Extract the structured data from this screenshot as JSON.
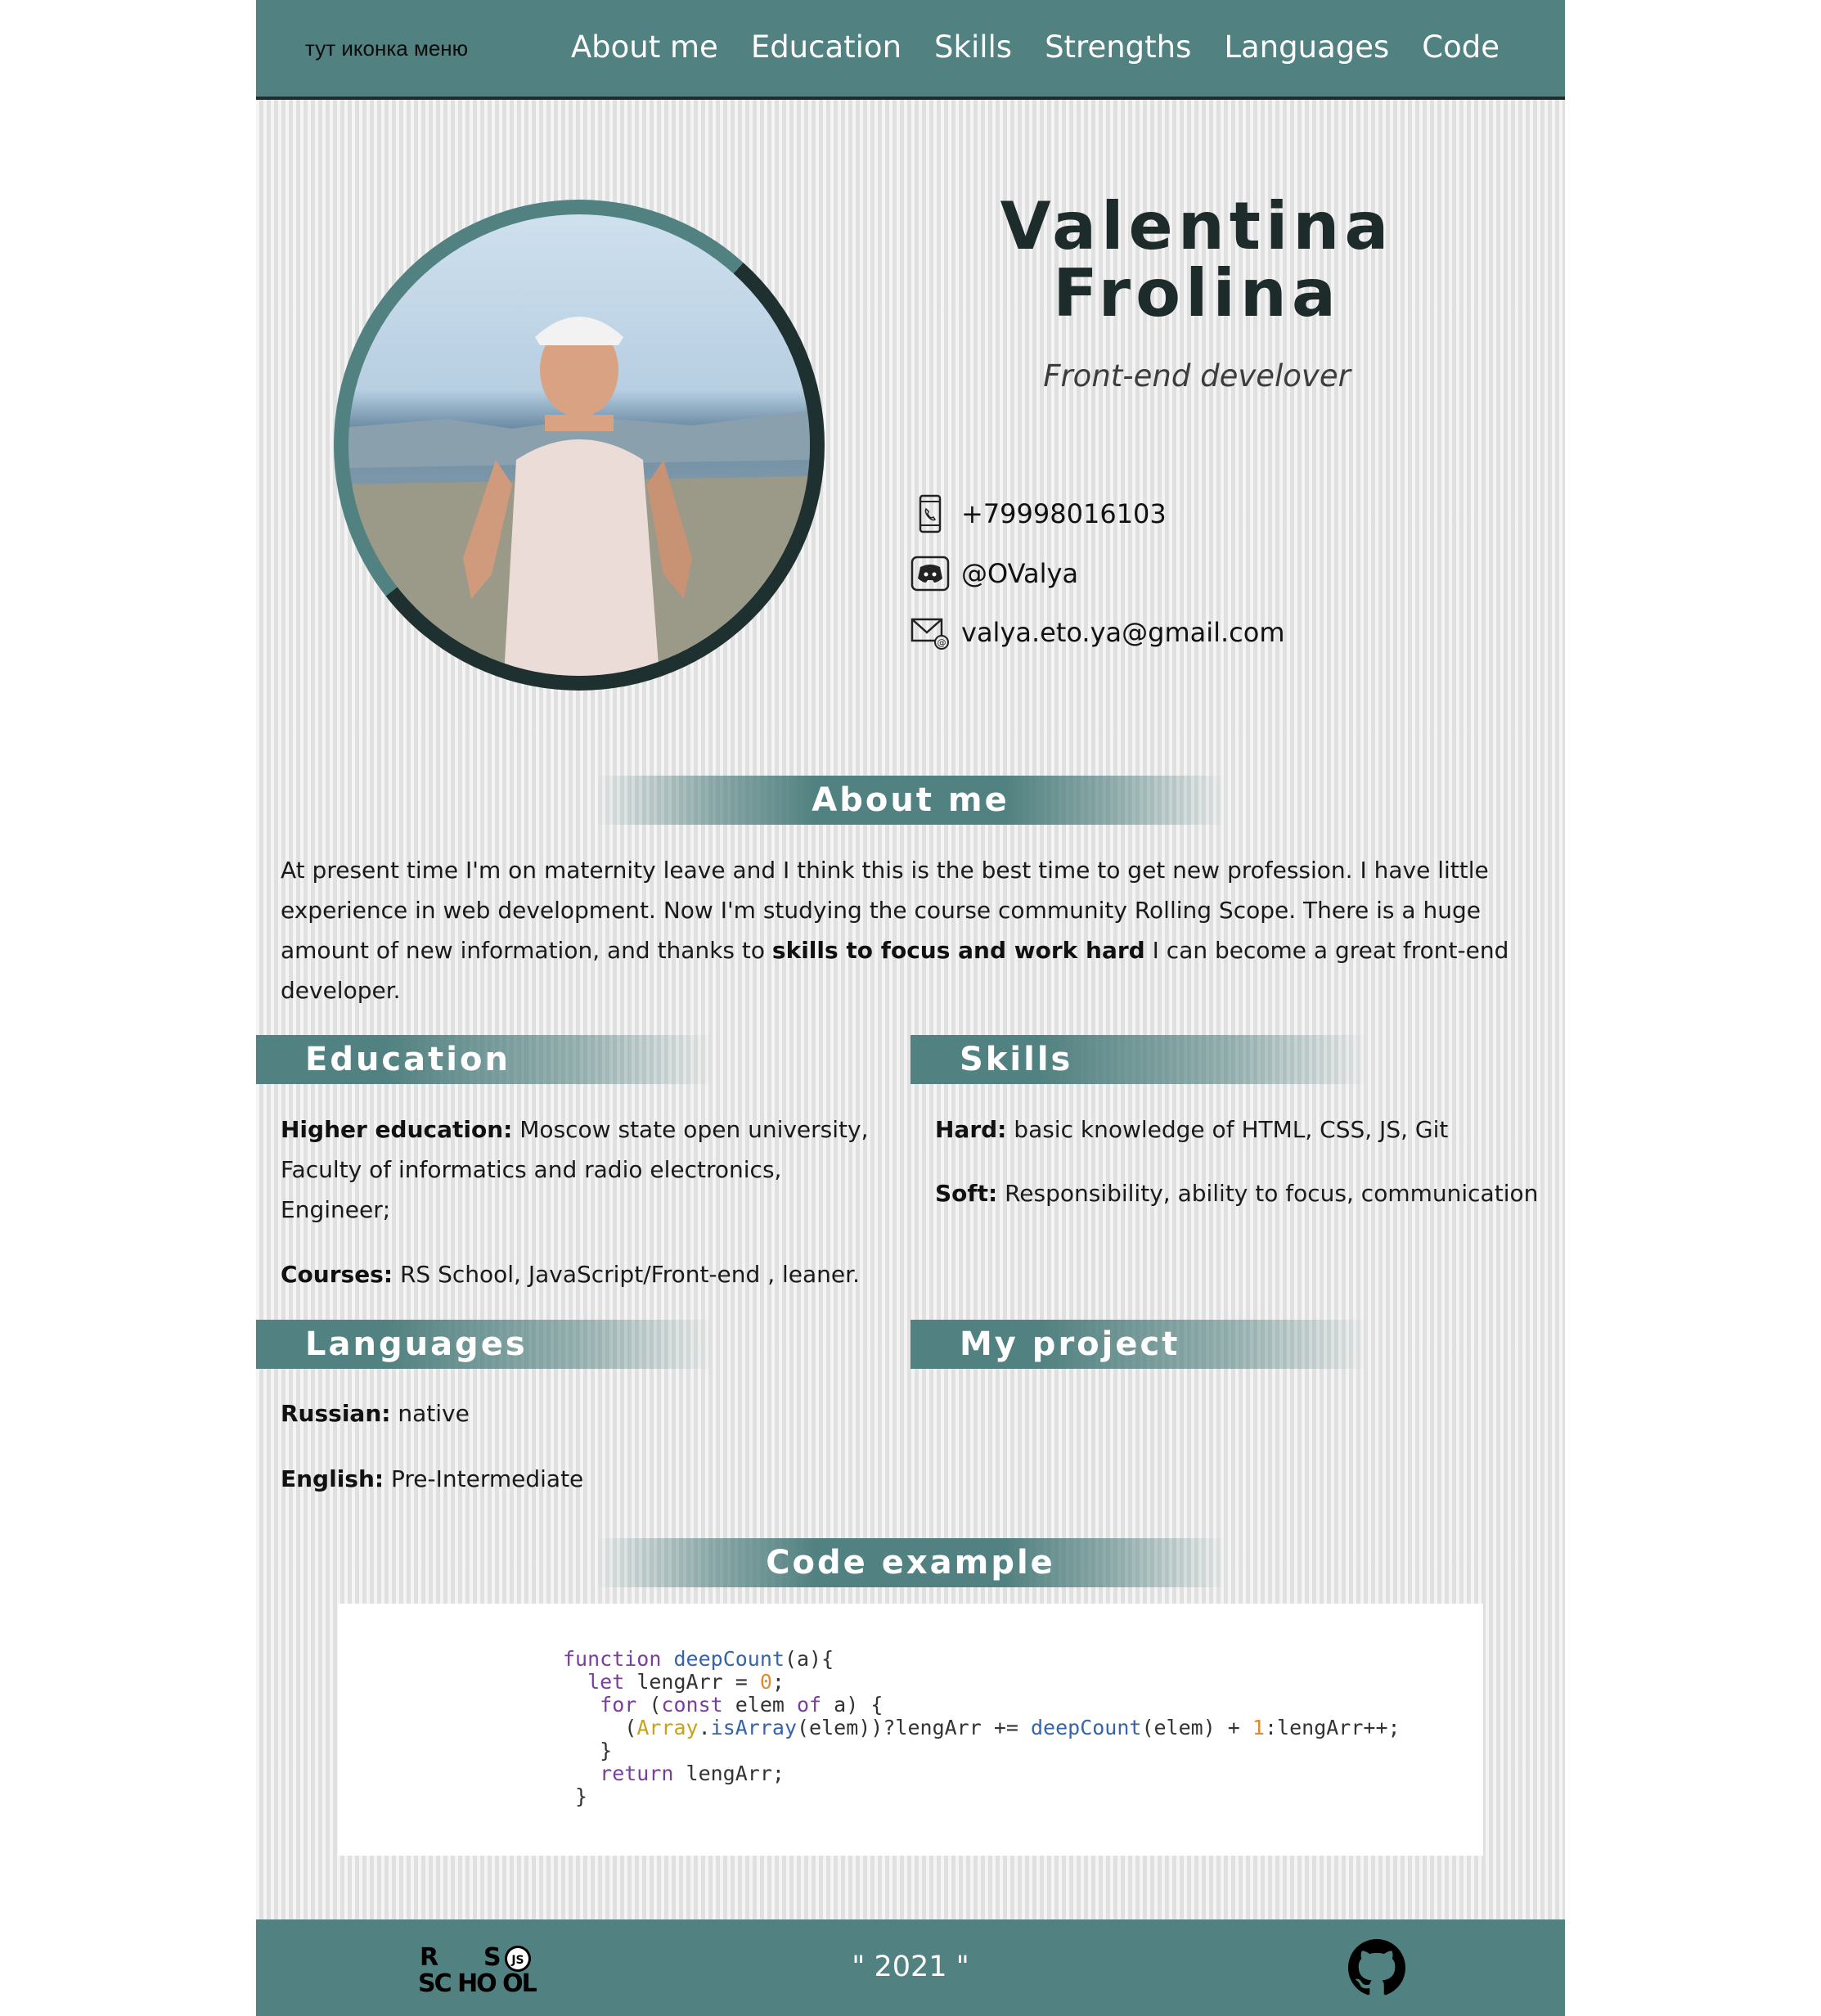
{
  "header": {
    "menu_icon_text": "тут иконка меню",
    "nav": [
      "About me",
      "Education",
      "Skills",
      "Strengths",
      "Languages",
      "Code"
    ]
  },
  "profile": {
    "first_name": "Valentina",
    "last_name": "Frolina",
    "role": "Front-end develover",
    "photo_icon": "profile-photo"
  },
  "contacts": {
    "phone": "+79998016103",
    "discord": "@OValya",
    "email": "valya.eto.ya@gmail.com"
  },
  "about": {
    "title": "About me",
    "text_before": "At present time I'm on maternity leave and I think this is the best time to get new profession. I have little experience in web development. Now I'm studying the course community Rolling Scope. There is a huge amount of new information, and thanks to ",
    "text_bold": "skills to focus and work hard",
    "text_after": " I can become a great front-end developer."
  },
  "education": {
    "title": "Education",
    "higher_label": "Higher education:",
    "higher_value": " Moscow state open university, Faculty of informatics and radio electronics, Engineer;",
    "courses_label": "Courses:",
    "courses_value": " RS School, JavaScript/Front-end , leaner."
  },
  "skills": {
    "title": "Skills",
    "hard_label": "Hard:",
    "hard_value": " basic knowledge of HTML, CSS, JS, Git",
    "soft_label": "Soft:",
    "soft_value": " Responsibility, ability to focus, communication"
  },
  "languages": {
    "title": "Languages",
    "russian_label": "Russian:",
    "russian_value": " native",
    "english_label": "English:",
    "english_value": " Pre-Intermediate"
  },
  "project": {
    "title": "My project"
  },
  "code": {
    "title": "Code example"
  },
  "footer": {
    "year": "\" 2021 \"",
    "logo_icon": "rs-school-logo",
    "github_icon": "github-icon"
  },
  "colors": {
    "accent": "#518180",
    "dark": "#1d2b2a"
  }
}
